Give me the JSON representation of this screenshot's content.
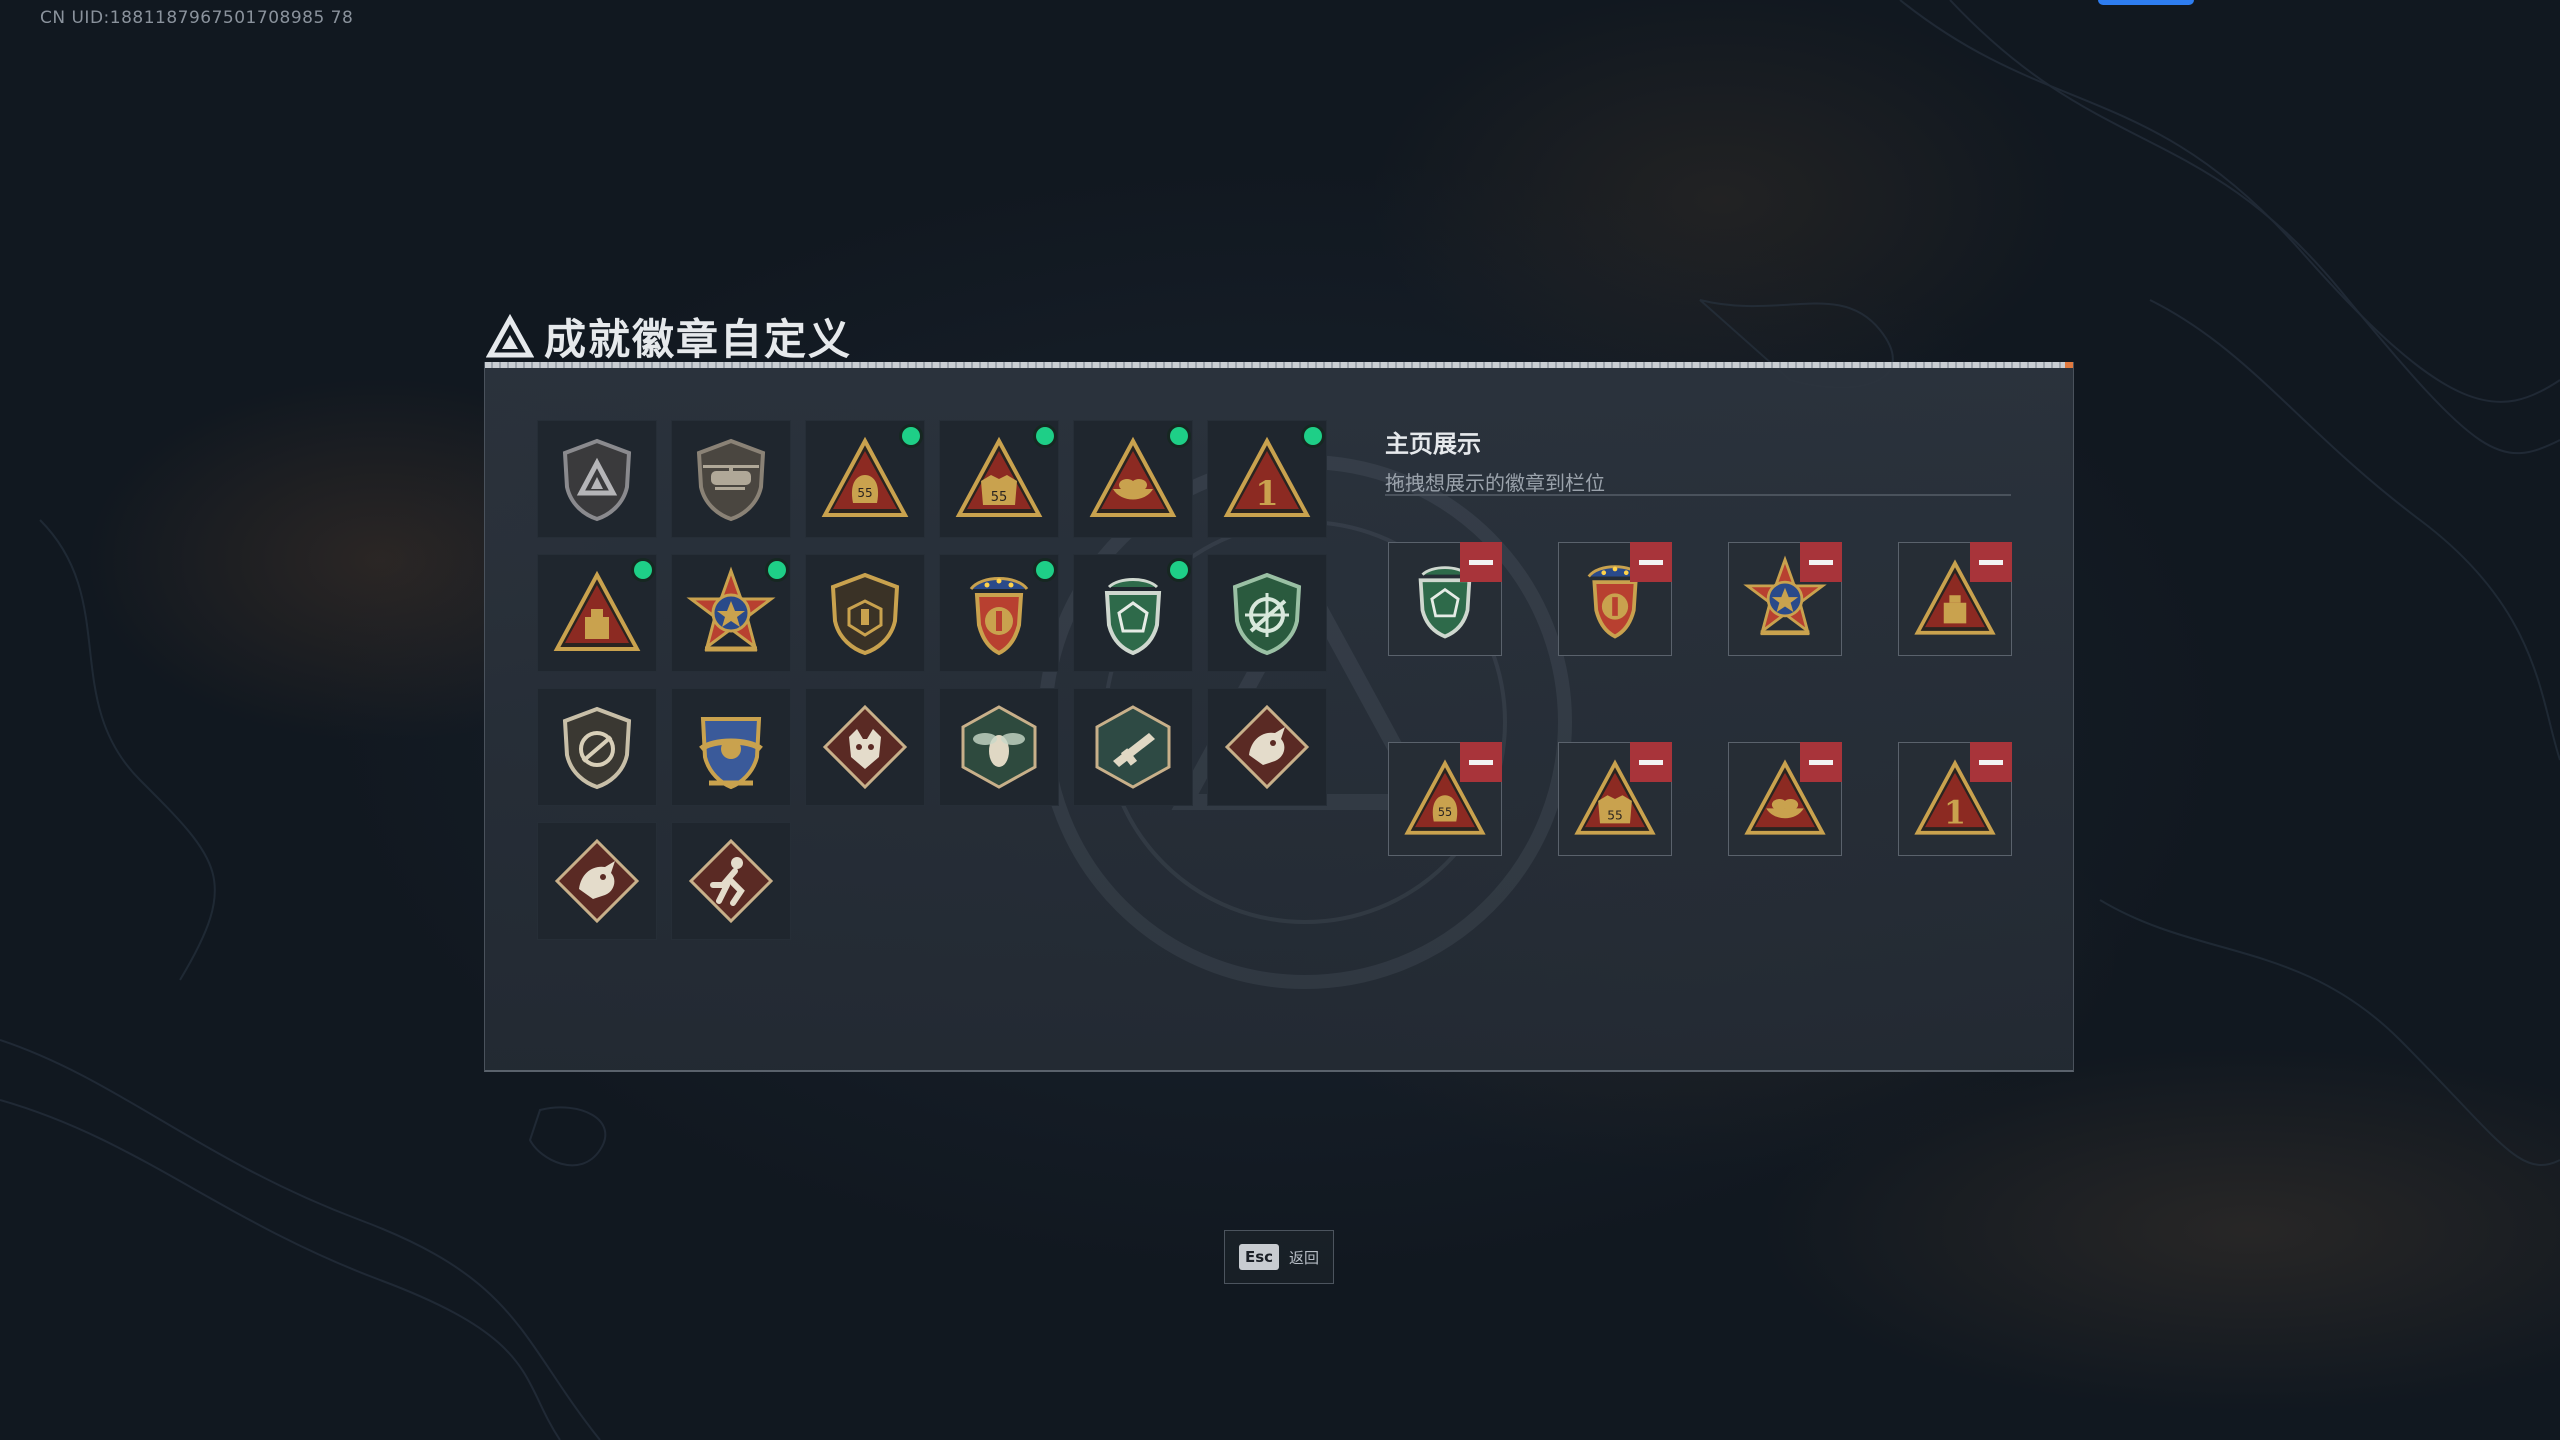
{
  "header": {
    "uid": "CN UID:1881187967501708985 78"
  },
  "panel": {
    "title": "成就徽章自定义",
    "title_icon": "triangle-logo-icon"
  },
  "showcase": {
    "title": "主页展示",
    "subtitle": "拖拽想展示的徽章到栏位"
  },
  "badges": [
    {
      "icon": "shield-triangle-badge",
      "new": false
    },
    {
      "icon": "helicopter-shield-badge",
      "new": false
    },
    {
      "icon": "gold-bag-55-badge",
      "new": true
    },
    {
      "icon": "gold-vest-55-badge",
      "new": true
    },
    {
      "icon": "gold-ingot-badge",
      "new": true
    },
    {
      "icon": "gold-number-one-badge",
      "new": true
    },
    {
      "icon": "gold-crate-badge",
      "new": true
    },
    {
      "icon": "star-medal-badge",
      "new": true
    },
    {
      "icon": "gold-shield-badge",
      "new": false
    },
    {
      "icon": "star-crest-badge",
      "new": true
    },
    {
      "icon": "green-gem-shield-badge",
      "new": true
    },
    {
      "icon": "green-crosshair-badge",
      "new": false
    },
    {
      "icon": "no-rifle-shield-badge",
      "new": false
    },
    {
      "icon": "blue-wing-crest-badge",
      "new": false
    },
    {
      "icon": "wolf-diamond-badge",
      "new": false
    },
    {
      "icon": "wasp-hex-badge",
      "new": false
    },
    {
      "icon": "rifle-hex-badge",
      "new": false
    },
    {
      "icon": "dragon-diamond-badge",
      "new": false
    },
    {
      "icon": "dragon-diamond-badge",
      "new": false
    },
    {
      "icon": "runner-diamond-badge",
      "new": false
    }
  ],
  "slots": [
    {
      "icon": "green-gem-shield-badge"
    },
    {
      "icon": "star-crest-badge"
    },
    {
      "icon": "star-medal-badge"
    },
    {
      "icon": "gold-crate-badge"
    },
    {
      "icon": "gold-bag-55-badge"
    },
    {
      "icon": "gold-vest-55-badge"
    },
    {
      "icon": "gold-ingot-badge"
    },
    {
      "icon": "gold-number-one-badge"
    }
  ],
  "footer": {
    "esc_key": "Esc",
    "esc_label": "返回"
  },
  "colors": {
    "accent_new": "#1ecf87",
    "remove": "#a8343a",
    "top_button": "#2e7df0"
  }
}
